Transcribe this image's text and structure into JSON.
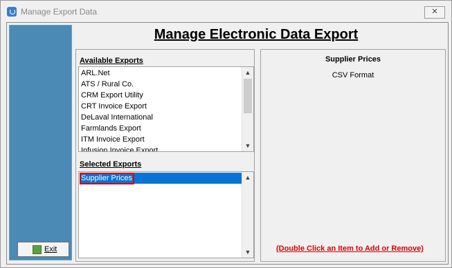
{
  "window": {
    "title": "Manage Export Data",
    "close_glyph": "✕"
  },
  "page": {
    "heading": "Manage Electronic Data Export"
  },
  "available": {
    "label": "Available Exports",
    "items": [
      "ARL.Net",
      "ATS / Rural Co.",
      "CRM Export Utility",
      "CRT Invoice Export",
      "DeLaval International",
      "Farmlands Export",
      "ITM Invoice Export",
      "Infusion Invoice Export"
    ]
  },
  "selected": {
    "label": "Selected Exports",
    "items": [
      "Supplier Prices"
    ]
  },
  "details": {
    "name": "Supplier Prices",
    "format": "CSV Format"
  },
  "hint": "(Double Click an Item to Add or Remove)",
  "sidebar": {
    "exit_label": "Exit"
  },
  "colors": {
    "sidebar": "#4a8ab4",
    "selection": "#0a74d6",
    "highlight": "#e00000",
    "hint": "#d40000"
  },
  "icons": {
    "app": "power-icon",
    "exit": "exit-door-icon",
    "scroll_up": "chevron-up-icon",
    "scroll_down": "chevron-down-icon"
  }
}
